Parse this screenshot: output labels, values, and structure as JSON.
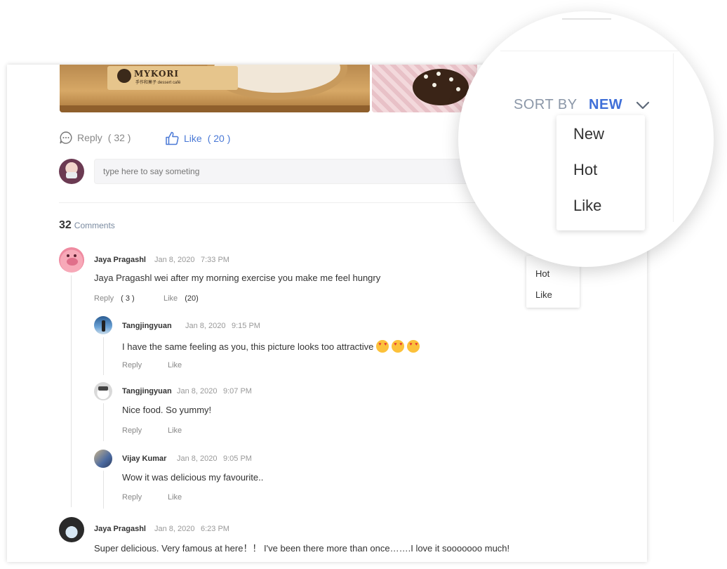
{
  "post": {
    "photo_brand": "MYKORI",
    "photo_brand_sub": "手作和菓子 dessert café",
    "reply_label": "Reply",
    "reply_count": "( 32 )",
    "like_label": "Like",
    "like_count": "( 20 )"
  },
  "composer": {
    "placeholder": "type here to say someting"
  },
  "comments_header": {
    "count": "32",
    "label": "Comments"
  },
  "comments": [
    {
      "author": "Jaya Pragashl",
      "date": "Jan 8, 2020",
      "time": "7:33 PM",
      "text": "Jaya Pragashl wei after my morning exercise you make me feel hungry",
      "reply_label": "Reply",
      "reply_count": "( 3 )",
      "like_label": "Like",
      "like_count": "(20)",
      "replies": [
        {
          "author": "Tangjingyuan",
          "date": "Jan 8, 2020",
          "time": "9:15 PM",
          "text": "I have the same feeling as you, this picture looks too attractive",
          "emoji": "heart-eyes-emoji",
          "reply_label": "Reply",
          "like_label": "Like"
        },
        {
          "author": "Tangjingyuan",
          "date": "Jan 8, 2020",
          "time": "9:07 PM",
          "text": "Nice food. So yummy!",
          "reply_label": "Reply",
          "like_label": "Like"
        },
        {
          "author": "Vijay Kumar",
          "date": "Jan 8, 2020",
          "time": "9:05 PM",
          "text": "Wow it was delicious my favourite..",
          "reply_label": "Reply",
          "like_label": "Like"
        }
      ]
    },
    {
      "author": "Jaya Pragashl",
      "date": "Jan 8, 2020",
      "time": "6:23 PM",
      "text": "Super delicious. Very famous at here！！ I've been there more than once…….I love it sooooooo much!"
    }
  ],
  "sort_menu": {
    "label": "SORT BY",
    "value": "NEW",
    "options": [
      "New",
      "Hot",
      "Like"
    ]
  },
  "small_sort_menu": {
    "options": [
      "Hot",
      "Like"
    ]
  },
  "colors": {
    "accent": "#3f6fd8",
    "like_blue": "#4a79d6",
    "muted": "#888888"
  }
}
